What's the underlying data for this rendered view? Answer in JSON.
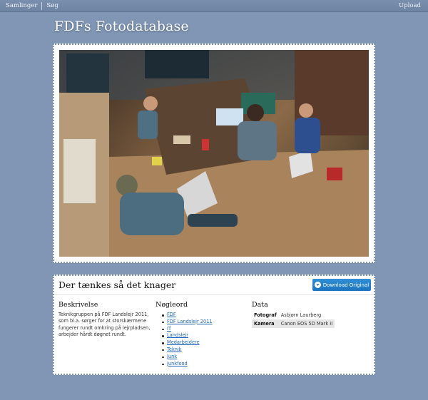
{
  "nav": {
    "left_items": [
      "Samlinger",
      "Søg"
    ],
    "upload_label": "Upload"
  },
  "site_title": "FDFs Fotodatabase",
  "photo": {
    "description": "Group of scouts working on laptops around a table"
  },
  "panel": {
    "title": "Der tænkes så det knager",
    "download_label": "Download Original",
    "description_heading": "Beskrivelse",
    "description_text": "Teknikgruppen på FDF Landslejr 2011, som bl.a. sørger for at storskærmene fungerer rundt omkring på lejrpladsen, arbejder hårdt døgnet rundt.",
    "keywords_heading": "Nøgleord",
    "keywords": [
      "FDF",
      "FDF Landslejr 2011",
      "IT",
      "Landslejr",
      "Medarbejdere",
      "Teknik",
      "Junk",
      "Junkfood"
    ],
    "data_heading": "Data",
    "data_rows": [
      {
        "key": "Fotograf",
        "value": "Asbjørn Laurberg"
      },
      {
        "key": "Kamera",
        "value": "Canon EOS 5D Mark II"
      }
    ]
  },
  "colors": {
    "background": "#8196b4",
    "accent_button": "#2481c9",
    "link": "#1f64b8"
  }
}
